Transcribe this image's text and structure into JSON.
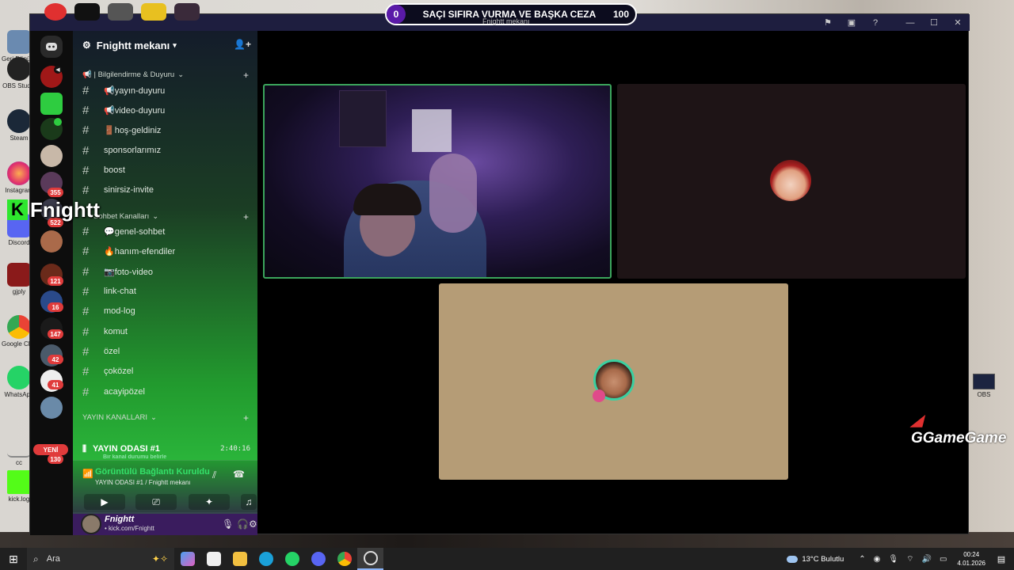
{
  "stream_banner": {
    "left_count": "0",
    "text": "SAÇI SIFIRA VURMA VE BAŞKA CEZA",
    "right_count": "100",
    "subtitle": "Fnightt mekanı"
  },
  "overlay": {
    "streamer_name": "Fnightt",
    "watermark": "GGameGame"
  },
  "desktop_icons": [
    {
      "label": "Geri Dönüşüm",
      "color": "#6a8ab0"
    },
    {
      "label": "OBS Studio",
      "color": "#222222"
    },
    {
      "label": "Steam",
      "color": "#1b2838"
    },
    {
      "label": "Instagram",
      "color": "#dcdcdc"
    },
    {
      "label": "Discord",
      "color": "#5865f2"
    },
    {
      "label": "gjply",
      "color": "#8a1a1a"
    },
    {
      "label": "Google Chrome",
      "color": "#dcdcdc"
    },
    {
      "label": "WhatsApp",
      "color": "#25d366"
    },
    {
      "label": "cc",
      "color": "#c0c0c0"
    },
    {
      "label": "kick.log",
      "color": "#53fc18"
    }
  ],
  "right_desktop_icon": {
    "label": "OBS"
  },
  "server": {
    "name": "Fnightt mekanı",
    "categories": [
      {
        "label": "📢 | Bilgilendirme & Duyuru"
      },
      {
        "label": "Sohbet Kanalları"
      },
      {
        "label": "YAYIN KANALLARI"
      }
    ],
    "channels": [
      {
        "name": "📢yayın-duyuru"
      },
      {
        "name": "📢video-duyuru"
      },
      {
        "name": "🚪hoş-geldiniz"
      },
      {
        "name": "sponsorlarımız"
      },
      {
        "name": "boost"
      },
      {
        "name": "sinirsiz-invite"
      },
      {
        "name": "💬genel-sohbet"
      },
      {
        "name": "🔥hanım-efendiler"
      },
      {
        "name": "📷foto-video"
      },
      {
        "name": "link-chat"
      },
      {
        "name": "mod-log"
      },
      {
        "name": "komut"
      },
      {
        "name": "özel"
      },
      {
        "name": "çoközel"
      },
      {
        "name": "acayipözel"
      }
    ],
    "voice_channel": {
      "name": "YAYIN ODASI #1",
      "timer": "2:40:16",
      "sub": "Bir kanal durumu belirle"
    }
  },
  "rail_badges": {
    "b1": "355",
    "b2": "522",
    "b3": "121",
    "b4": "16",
    "b5": "147",
    "b6": "42",
    "b7": "41",
    "new_label": "YENİ",
    "b8": "130"
  },
  "voice_panel": {
    "status": "Görüntülü Bağlantı Kuruldu",
    "location": "YAYIN ODASI #1 / Fnightt mekanı"
  },
  "user": {
    "name": "Fnightt",
    "status": "• kick.com/Fnightt"
  },
  "taskbar": {
    "search_placeholder": "Ara",
    "weather": "13°C  Bulutlu",
    "time": "00:24",
    "date": "4.01.2026"
  },
  "colors": {
    "accent_green": "#3ba55c",
    "badge_red": "#e03b3b",
    "banner_purple": "#5a1aa8"
  }
}
